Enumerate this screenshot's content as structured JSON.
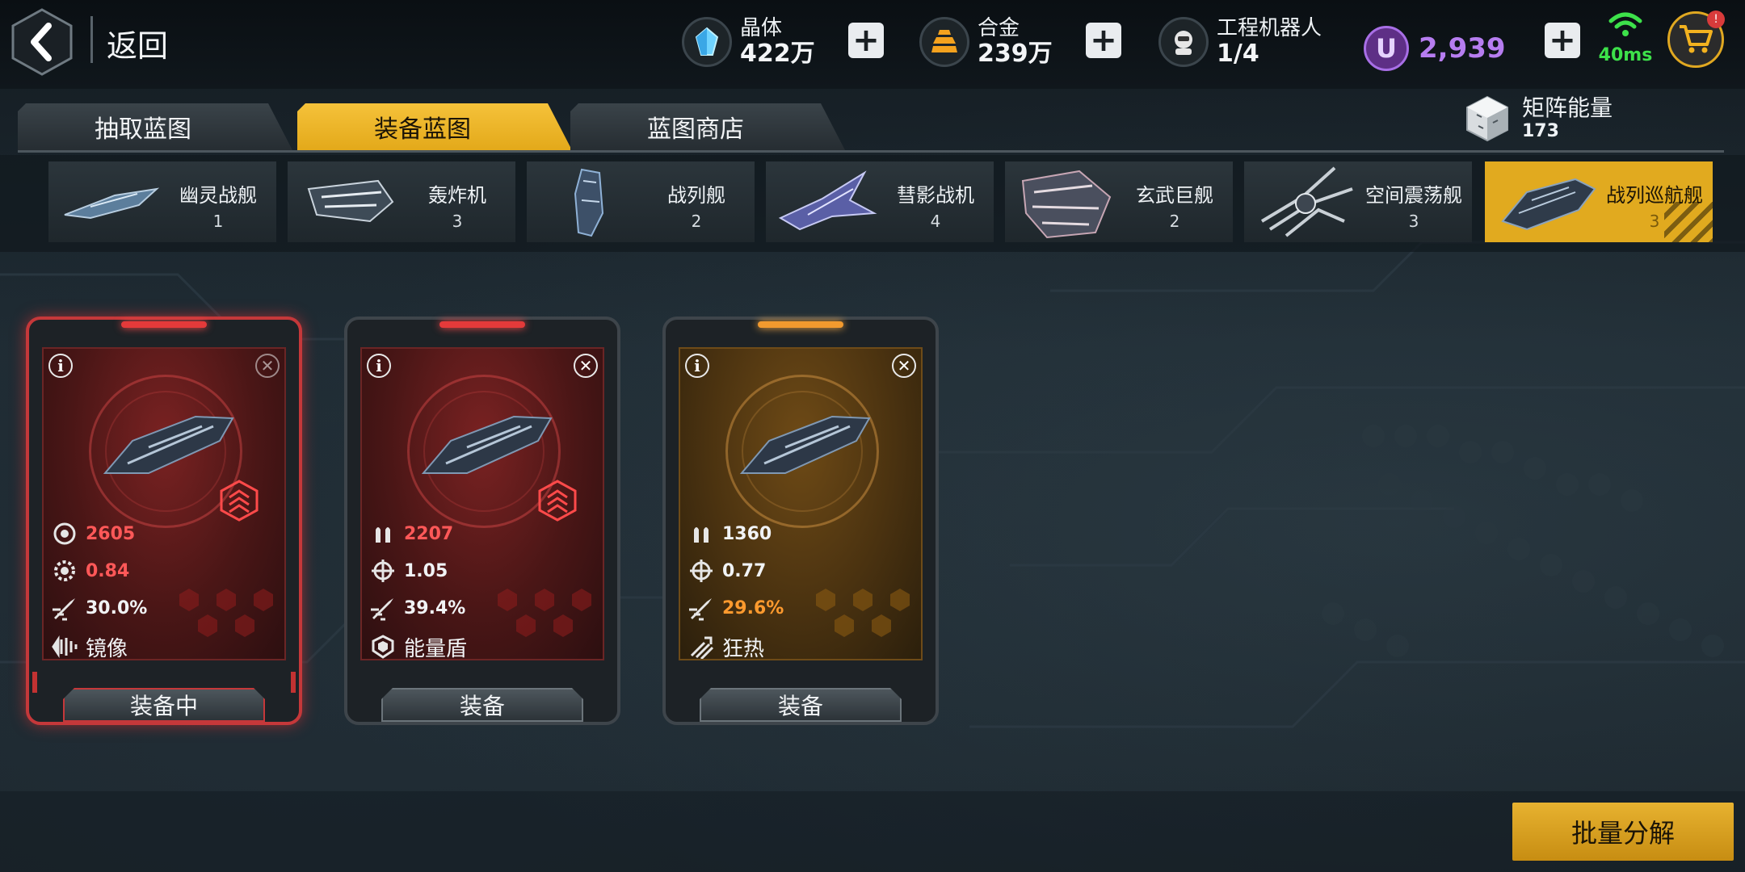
{
  "header": {
    "back_label": "返回",
    "resources": [
      {
        "label": "晶体",
        "value": "422万",
        "icon": "crystal-icon"
      },
      {
        "label": "合金",
        "value": "239万",
        "icon": "alloy-icon"
      },
      {
        "label": "工程机器人",
        "value": "1/4",
        "icon": "robot-icon"
      }
    ],
    "currency": {
      "symbol": "U",
      "value": "2,939"
    },
    "ping": "40ms",
    "cart_badge": "!"
  },
  "tabs": [
    {
      "label": "抽取蓝图",
      "active": false
    },
    {
      "label": "装备蓝图",
      "active": true
    },
    {
      "label": "蓝图商店",
      "active": false
    }
  ],
  "matrix": {
    "label": "矩阵能量",
    "value": "173"
  },
  "ships": [
    {
      "name": "幽灵战舰",
      "count": "1"
    },
    {
      "name": "轰炸机",
      "count": "3"
    },
    {
      "name": "战列舰",
      "count": "2"
    },
    {
      "name": "彗影战机",
      "count": "4"
    },
    {
      "name": "玄武巨舰",
      "count": "2"
    },
    {
      "name": "空间震荡舰",
      "count": "3"
    },
    {
      "name": "战列巡航舰",
      "count": "3",
      "active": true
    }
  ],
  "cards": [
    {
      "stat1": "2605",
      "stat2": "0.84",
      "stat3": "30.0%",
      "skill": "镜像",
      "button": "装备中",
      "theme": "red"
    },
    {
      "stat1": "2207",
      "stat2": "1.05",
      "stat3": "39.4%",
      "skill": "能量盾",
      "button": "装备",
      "theme": "red"
    },
    {
      "stat1": "1360",
      "stat2": "0.77",
      "stat3": "29.6%",
      "skill": "狂热",
      "button": "装备",
      "theme": "orange"
    }
  ],
  "bulk_button": "批量分解",
  "colors": {
    "accent": "#e9b326",
    "red": "#ff5858",
    "orange": "#ff9a2e",
    "currency": "#b67df0",
    "ping": "#3de14a"
  }
}
